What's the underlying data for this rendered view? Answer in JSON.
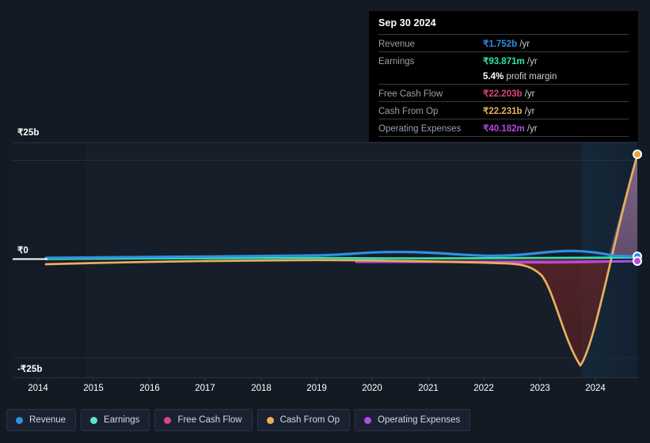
{
  "tooltip": {
    "title": "Sep 30 2024",
    "rows": [
      {
        "key": "Revenue",
        "amount": "₹1.752b",
        "unit": "/yr",
        "color": "#2f8fe0"
      },
      {
        "key": "Earnings",
        "amount": "₹93.871m",
        "unit": "/yr",
        "color": "#2ee6b0"
      },
      {
        "key": "",
        "amount": "5.4%",
        "unit": "profit margin",
        "color": "#ffffff",
        "is_margin": true
      },
      {
        "key": "Free Cash Flow",
        "amount": "₹22.203b",
        "unit": "/yr",
        "color": "#e0457b"
      },
      {
        "key": "Cash From Op",
        "amount": "₹22.231b",
        "unit": "/yr",
        "color": "#e8b05c"
      },
      {
        "key": "Operating Expenses",
        "amount": "₹40.182m",
        "unit": "/yr",
        "color": "#b44ae0"
      }
    ]
  },
  "legend": {
    "items": [
      {
        "label": "Revenue",
        "color": "#2f8fe0"
      },
      {
        "label": "Earnings",
        "color": "#5fe8c4"
      },
      {
        "label": "Free Cash Flow",
        "color": "#e0457b"
      },
      {
        "label": "Cash From Op",
        "color": "#e8b05c"
      },
      {
        "label": "Operating Expenses",
        "color": "#b44ae0"
      }
    ]
  },
  "axes": {
    "y_labels": [
      "₹25b",
      "₹0",
      "-₹25b"
    ],
    "y_top": "₹25b",
    "y_mid": "₹0",
    "y_bot": "-₹25b",
    "x_labels": [
      "2014",
      "2015",
      "2016",
      "2017",
      "2018",
      "2019",
      "2020",
      "2021",
      "2022",
      "2023",
      "2024"
    ]
  },
  "chart_data": {
    "type": "line",
    "title": "",
    "xlabel": "",
    "ylabel": "",
    "ylim": [
      -25,
      25
    ],
    "y_unit": "INR billions",
    "y_ticks": [
      25,
      0,
      -25
    ],
    "y_tick_labels": [
      "₹25b",
      "₹0",
      "-₹25b"
    ],
    "grid": true,
    "legend_position": "bottom",
    "x": [
      "2014",
      "2015",
      "2016",
      "2017",
      "2018",
      "2019",
      "2020",
      "2021",
      "2022",
      "2023",
      "2024",
      "2024.75"
    ],
    "series": [
      {
        "name": "Revenue",
        "color": "#2f8fe0",
        "values": [
          0.25,
          0.32,
          0.45,
          0.52,
          0.62,
          0.75,
          0.85,
          0.9,
          1.0,
          1.45,
          1.6,
          1.752
        ],
        "last_value_label": "₹1.752b"
      },
      {
        "name": "Earnings",
        "color": "#5fe8c4",
        "values": [
          0.05,
          0.06,
          0.08,
          0.09,
          0.1,
          0.12,
          0.08,
          0.07,
          0.09,
          0.09,
          0.09,
          0.093871
        ],
        "last_value_label": "₹93.871m"
      },
      {
        "name": "Free Cash Flow",
        "color": "#e0457b",
        "values": [
          null,
          null,
          null,
          null,
          null,
          null,
          -0.2,
          -0.3,
          -0.4,
          -0.5,
          8.0,
          22.203
        ],
        "last_value_label": "₹22.203b"
      },
      {
        "name": "Cash From Op",
        "color": "#e8b05c",
        "values": [
          -0.6,
          -0.5,
          -0.4,
          -0.3,
          -0.2,
          -0.1,
          -0.15,
          -0.4,
          -0.6,
          -22.5,
          -4.0,
          22.231
        ],
        "last_value_label": "₹22.231b",
        "trough": {
          "x": "2023.6",
          "value": -22.5
        }
      },
      {
        "name": "Operating Expenses",
        "color": "#b44ae0",
        "values": [
          null,
          null,
          null,
          null,
          null,
          null,
          -0.6,
          -0.6,
          -0.6,
          -0.6,
          -0.6,
          0.040182
        ],
        "last_value_label": "₹40.182m"
      }
    ]
  },
  "colors": {
    "background": "#141a24",
    "plot_background": "#141b26",
    "gridline": "#2a3140",
    "zero_line": "#ffffff",
    "tooltip_background": "#000000",
    "highlight_band": "#16283a"
  }
}
